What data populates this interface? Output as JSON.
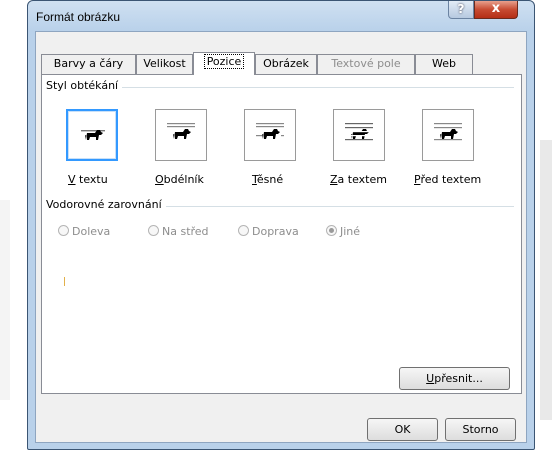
{
  "window": {
    "title": "Formát obrázku",
    "help_label": "?",
    "close_label": "x"
  },
  "tabs": [
    {
      "label": "Barvy a čáry",
      "active": false,
      "disabled": false
    },
    {
      "label": "Velikost",
      "active": false,
      "disabled": false
    },
    {
      "label": "Pozice",
      "active": true,
      "disabled": false
    },
    {
      "label": "Obrázek",
      "active": false,
      "disabled": false
    },
    {
      "label": "Textové pole",
      "active": false,
      "disabled": true
    },
    {
      "label": "Web",
      "active": false,
      "disabled": false
    }
  ],
  "wrapping": {
    "heading": "Styl obtékání",
    "options": [
      {
        "label": "V textu",
        "accesskey": "V",
        "rest": " textu",
        "icon": "inline-dog-icon",
        "selected": true
      },
      {
        "label": "Obdélník",
        "accesskey": "O",
        "rest": "bdélník",
        "icon": "square-dog-icon",
        "selected": false
      },
      {
        "label": "Těsné",
        "accesskey": "T",
        "rest": "ěsné",
        "icon": "tight-dog-icon",
        "selected": false
      },
      {
        "label": "Za textem",
        "accesskey": "Z",
        "rest": "a textem",
        "icon": "behind-text-dog-icon",
        "selected": false
      },
      {
        "label": "Před textem",
        "accesskey": "P",
        "rest": "řed textem",
        "icon": "in-front-dog-icon",
        "selected": false
      }
    ]
  },
  "alignment": {
    "heading": "Vodorovné zarovnání",
    "options": [
      {
        "label": "Doleva",
        "checked": false
      },
      {
        "label": "Na střed",
        "checked": false
      },
      {
        "label": "Doprava",
        "checked": false
      },
      {
        "label": "Jiné",
        "checked": true
      }
    ]
  },
  "buttons": {
    "advanced_key": "U",
    "advanced_rest": "přesnit...",
    "ok": "OK",
    "cancel": "Storno"
  }
}
